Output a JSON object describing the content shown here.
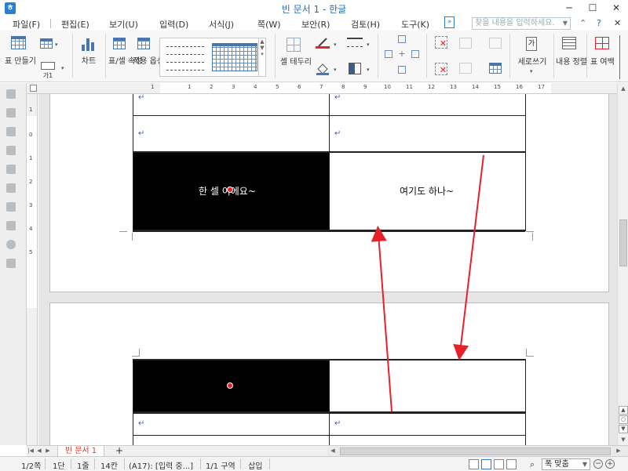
{
  "window": {
    "title": "빈 문서 1 - 한글",
    "app_icon": "hangul-app-icon",
    "minimize": "─",
    "maximize": "☐",
    "close": "✕"
  },
  "menu": {
    "items": [
      "파일(F)",
      "편집(E)",
      "보기(U)",
      "입력(D)",
      "서식(J)",
      "쪽(W)",
      "보안(R)",
      "검토(H)",
      "도구(K)"
    ],
    "more": "»",
    "search_placeholder": "찾을 내용을 입력하세요.",
    "help": "?",
    "close_doc": "✕",
    "collapse_ribbon": "⌃"
  },
  "toolbar": {
    "table_make": "표 만들기",
    "table_sub": "가1",
    "chart": "차트",
    "table_props": "표/셀 속성",
    "apply_options": "적용 옵션",
    "cell_border": "셀 테두리",
    "vertical_write": "세로쓰기",
    "content_align": "내용 정렬",
    "table_margin": "표 여백"
  },
  "ruler": {
    "h_numbers": [
      "1",
      "1",
      "2",
      "3",
      "4",
      "5",
      "6",
      "7",
      "8",
      "9",
      "10",
      "11",
      "12",
      "13",
      "14",
      "15",
      "16",
      "17"
    ],
    "v_numbers": [
      "1",
      "0",
      "1",
      "2",
      "3",
      "4",
      "5"
    ]
  },
  "document": {
    "para_mark": "↵",
    "cell_text_left": "한 셀 이에요~",
    "cell_text_right": "여기도 하나~",
    "colors": {
      "red_line": "#e8202a",
      "green_line": "#6aa84f",
      "arrow": "#e8202a"
    }
  },
  "tabs": {
    "first": "|◀",
    "prev": "◀",
    "next": "▶",
    "last": "▶|",
    "doc_tab": "빈 문서 1",
    "add": "+"
  },
  "status": {
    "page": "1/2쪽",
    "column": "1단",
    "line": "1줄",
    "char": "14칸",
    "cell": "(A17): [입력 중...]",
    "section": "1/1 구역",
    "mode": "삽입",
    "zoom": "폭 맞춤",
    "zoom_out": "−",
    "zoom_in": "+"
  }
}
